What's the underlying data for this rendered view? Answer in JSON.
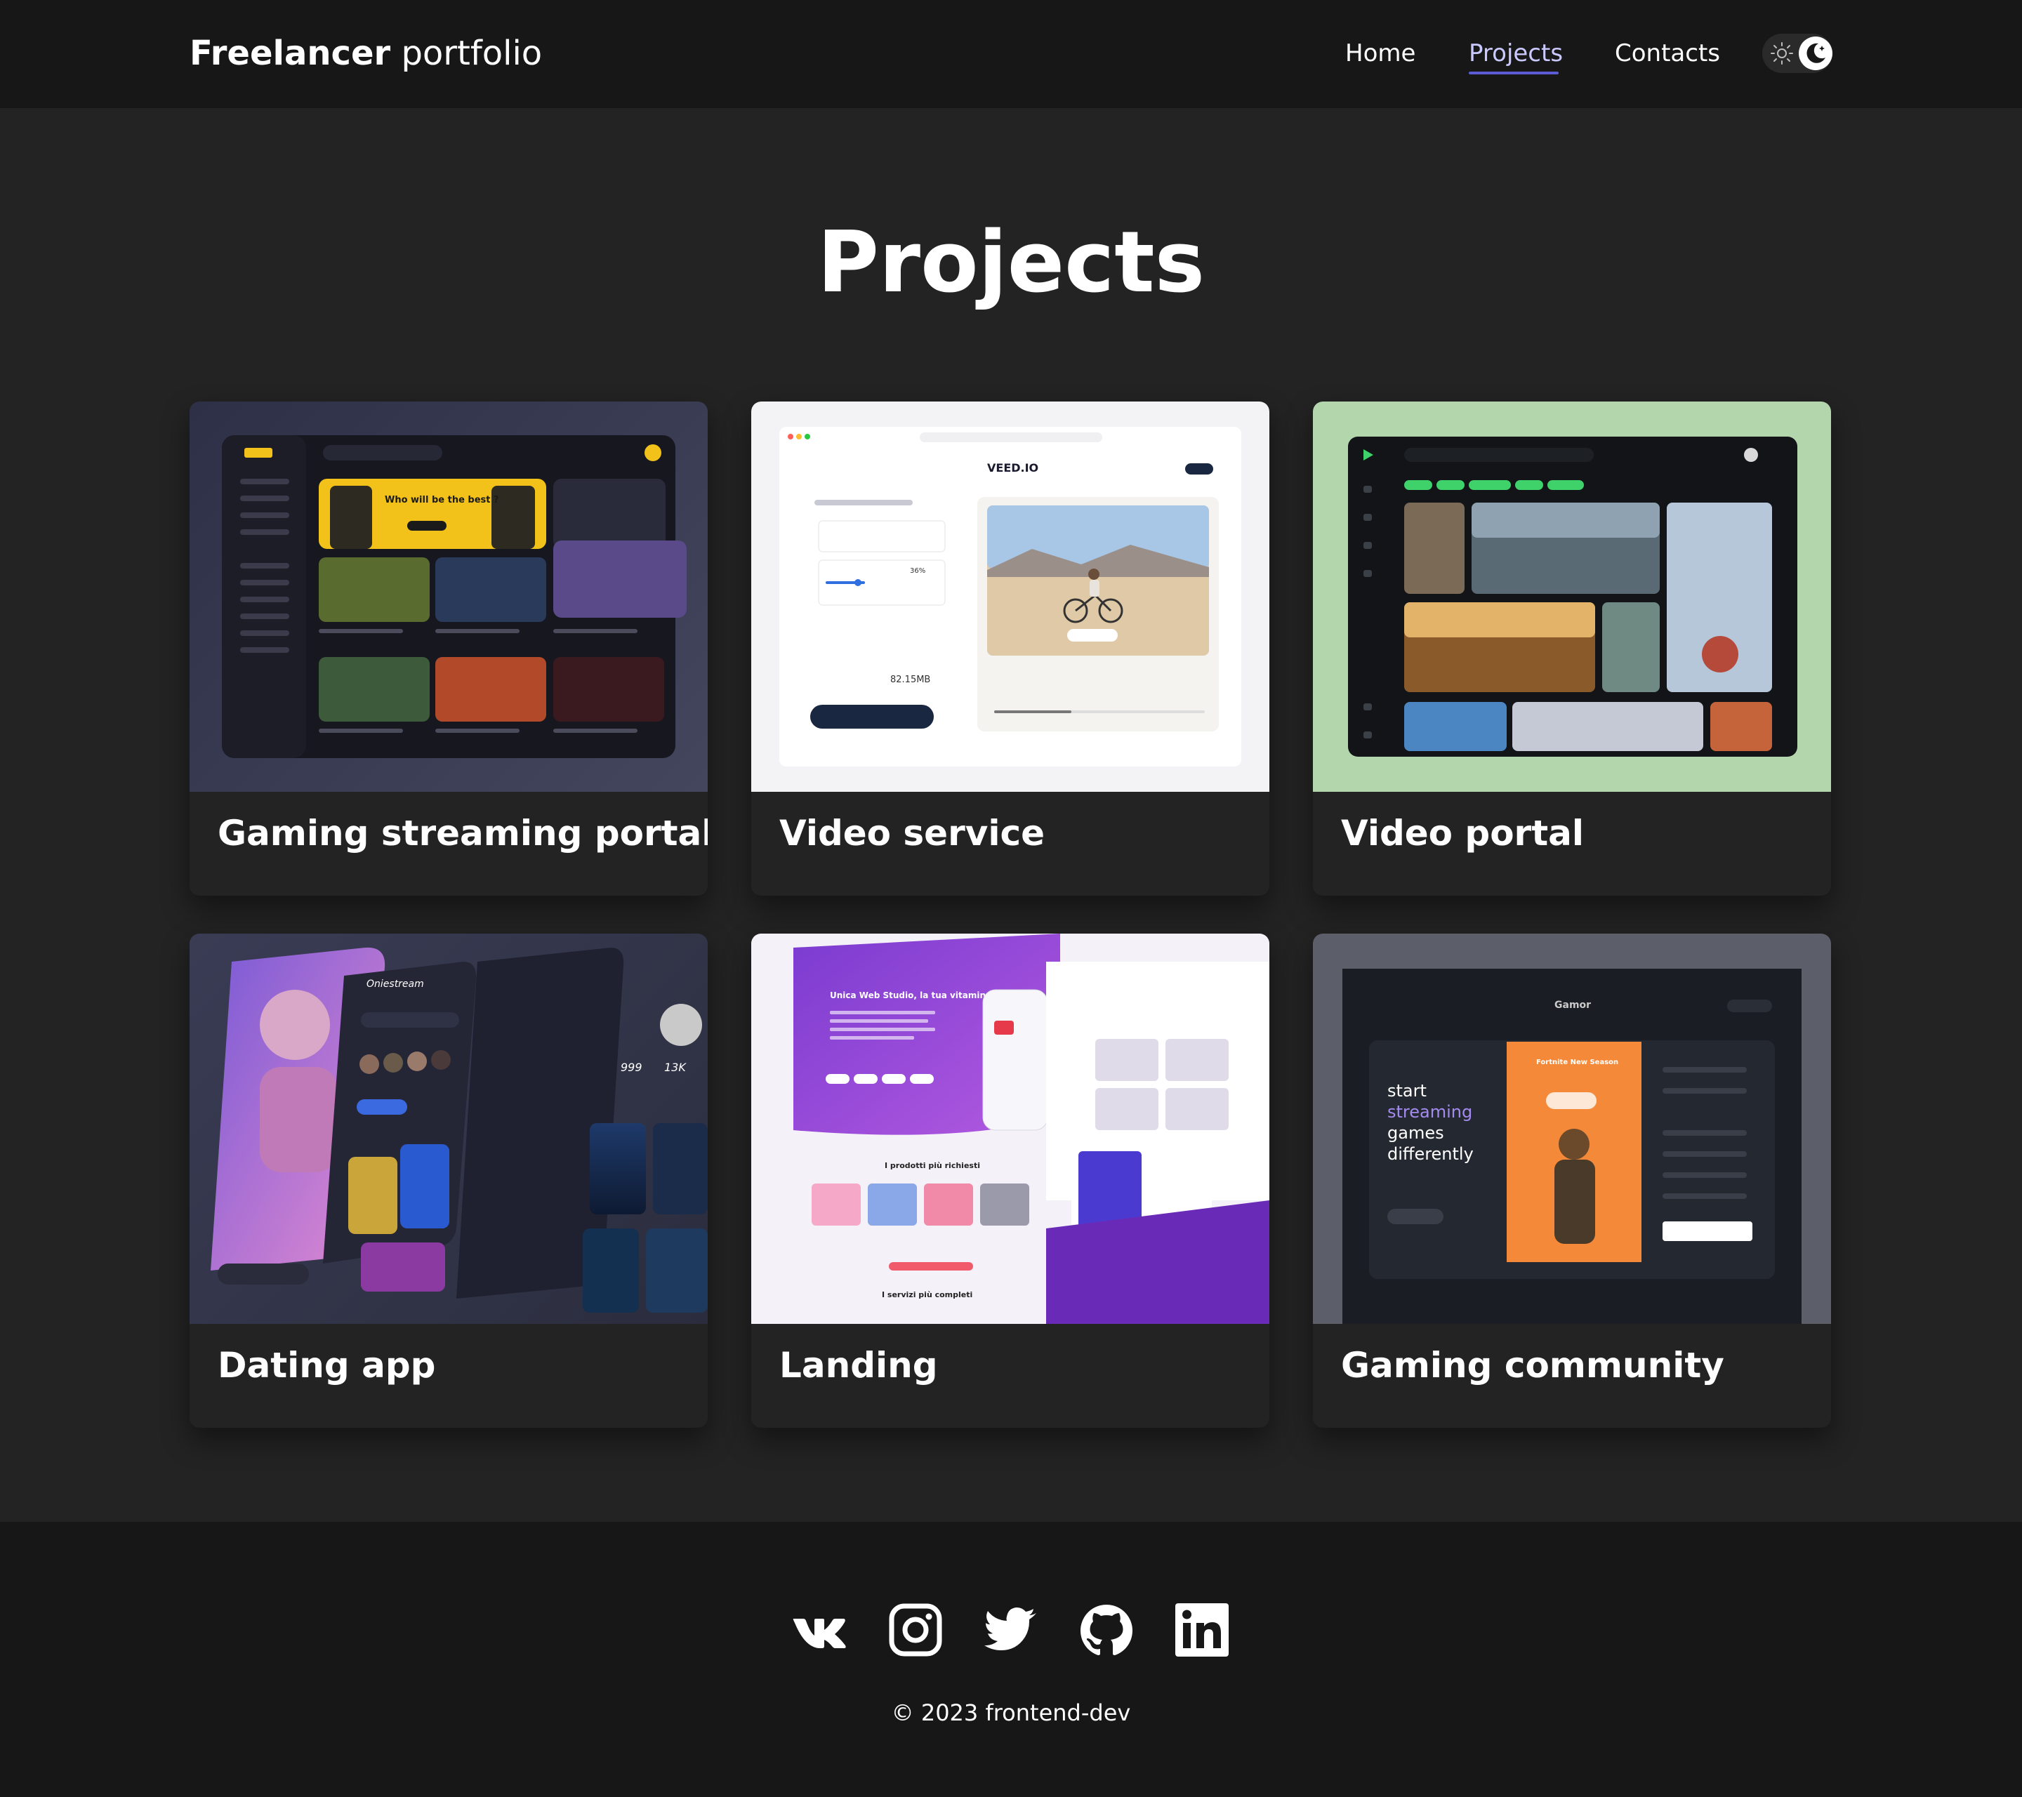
{
  "header": {
    "logo_bold": "Freelancer",
    "logo_light": " portfolio",
    "nav": [
      {
        "label": "Home"
      },
      {
        "label": "Projects"
      },
      {
        "label": "Contacts"
      }
    ]
  },
  "main": {
    "title": "Projects",
    "projects": [
      {
        "label": "Gaming streaming portal",
        "thumb_bg": "#3a3b52"
      },
      {
        "label": "Video service",
        "thumb_bg": "#f6f6f8"
      },
      {
        "label": "Video portal",
        "thumb_bg": "#b3d6ad"
      },
      {
        "label": "Dating app",
        "thumb_bg": "#3d3f58"
      },
      {
        "label": "Landing",
        "thumb_bg": "#8c4bd1"
      },
      {
        "label": "Gaming community",
        "thumb_bg": "#5c5f6a"
      }
    ],
    "thumb_text": {
      "gaming_heading": "Who will be the best ?",
      "veed_logo": "VEED.IO",
      "veed_size": "82.15MB",
      "veed_percent": "36%",
      "dating_app_name": "Oniestream",
      "dating_stat1": "999",
      "dating_stat2": "13K",
      "landing_headline": "Unica Web Studio, la tua vitamina social!",
      "landing_products": "I prodotti più richiesti",
      "landing_services": "I servizi più completi",
      "gamor_logo": "Gamor",
      "gamor_tagline1": "start",
      "gamor_tagline2": "streaming",
      "gamor_tagline3": "games",
      "gamor_tagline4": "differently",
      "gamor_card_title": "Fortnite New Season"
    }
  },
  "footer": {
    "icons": [
      "vk-icon",
      "instagram-icon",
      "twitter-icon",
      "github-icon",
      "linkedin-icon"
    ],
    "copyright": "© 2023 frontend-dev"
  },
  "colors": {
    "background": "#232323",
    "header_bg": "#171717",
    "accent": "#5b5bd6"
  }
}
